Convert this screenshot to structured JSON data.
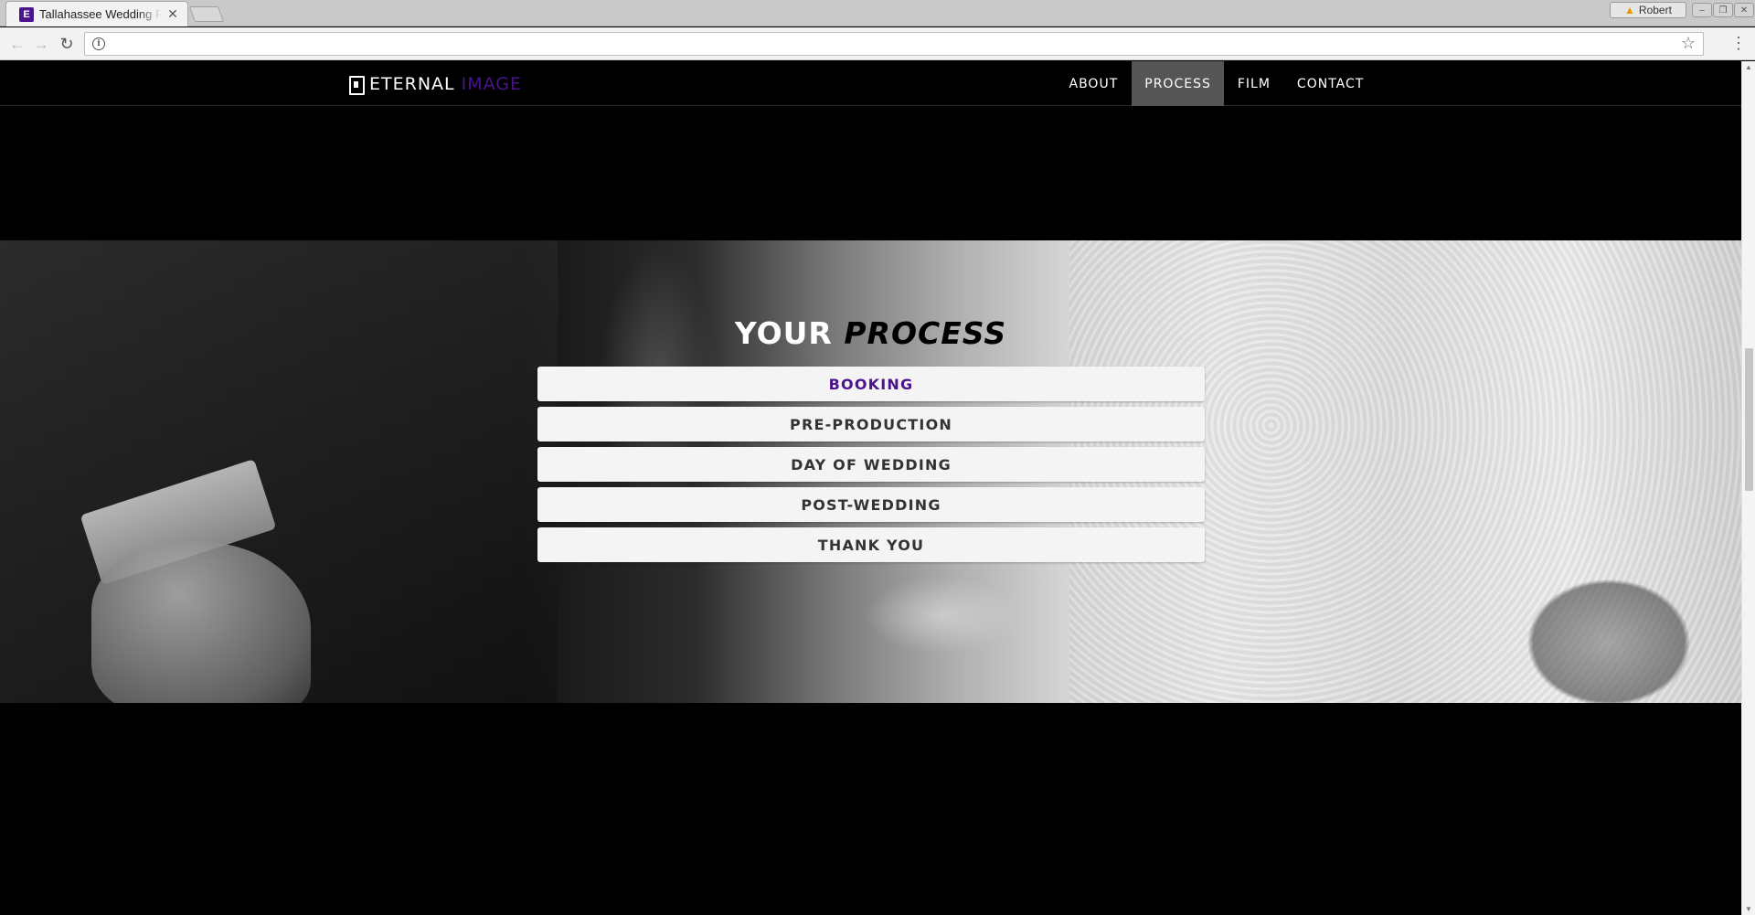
{
  "browser": {
    "tab_title": "Tallahassee Wedding F",
    "tab_favicon": "E",
    "profile_name": "Robert",
    "address": ""
  },
  "icons": {
    "back": "back-arrow-icon",
    "forward": "forward-arrow-icon",
    "reload": "reload-icon",
    "info": "info-icon",
    "star": "bookmark-star-icon",
    "menu": "kebab-menu-icon",
    "brand": "document-logo-icon"
  },
  "site": {
    "brand_word1": "ETERNAL",
    "brand_word2": "IMAGE",
    "nav": [
      {
        "label": "ABOUT",
        "active": false
      },
      {
        "label": "PROCESS",
        "active": true
      },
      {
        "label": "FILM",
        "active": false
      },
      {
        "label": "CONTACT",
        "active": false
      }
    ]
  },
  "process": {
    "title_word1": "YOUR",
    "title_word2": "PROCESS",
    "steps": [
      {
        "label": "BOOKING",
        "active": true
      },
      {
        "label": "PRE-PRODUCTION",
        "active": false
      },
      {
        "label": "DAY OF WEDDING",
        "active": false
      },
      {
        "label": "POST-WEDDING",
        "active": false
      },
      {
        "label": "THANK YOU",
        "active": false
      }
    ]
  },
  "colors": {
    "accent": "#4a148c",
    "nav_active_bg": "#555555",
    "page_bg": "#000000",
    "step_bg": "#f4f4f4"
  }
}
